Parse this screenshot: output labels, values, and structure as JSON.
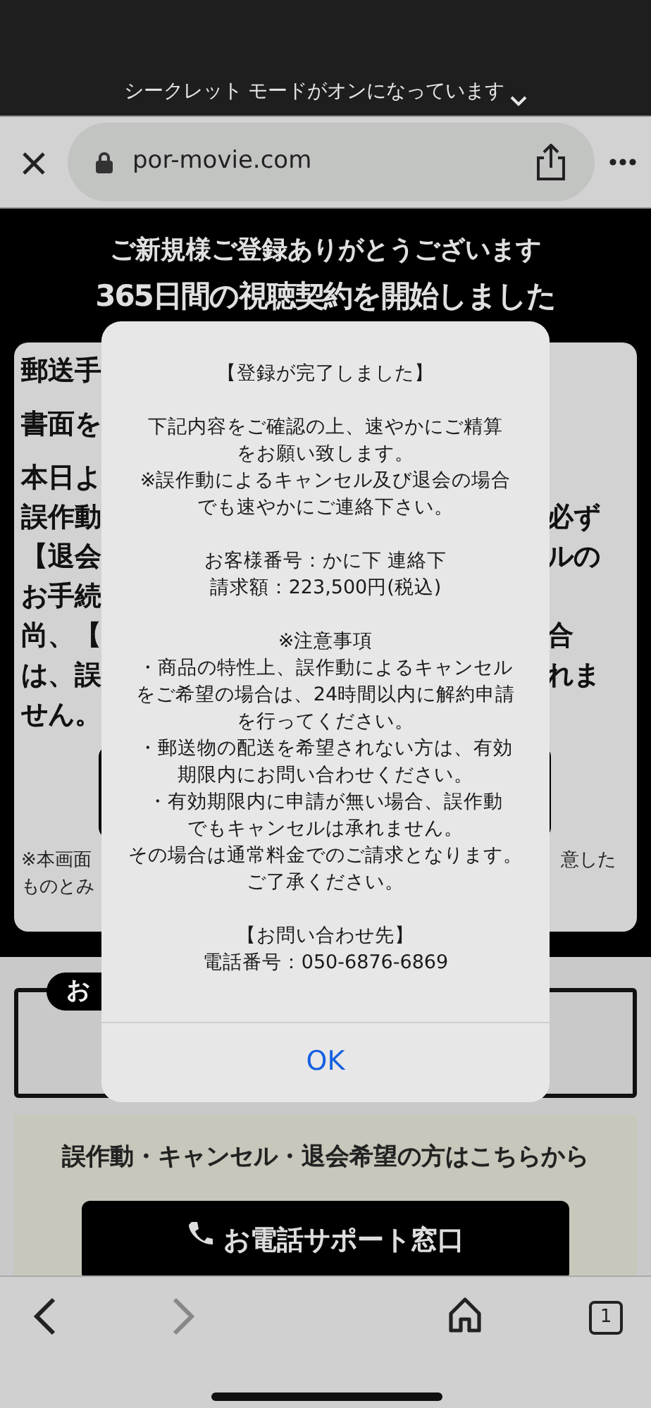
{
  "status_banner": {
    "text": "シークレット モードがオンになっています"
  },
  "address_bar": {
    "url": "por-movie.com"
  },
  "page": {
    "header": {
      "line_1": "ご新規様ご登録ありがとうございます",
      "line_2": "365日間の視聴契約を開始しました"
    },
    "notice_card": {
      "paragraphs": [
        [
          {
            "left": "郵送手"
          }
        ],
        [
          {
            "left": "書面を"
          }
        ],
        [
          {
            "left": "本日よ"
          },
          {
            "left": "誤作動",
            "right": "必ず"
          },
          {
            "left": "【退会",
            "right": "ルの"
          },
          {
            "left": "お手続"
          },
          {
            "left": "尚、【",
            "right": "合"
          },
          {
            "left": "は、誤",
            "right": "れま"
          },
          {
            "left": "せん。"
          }
        ]
      ],
      "note_lines": [
        {
          "left": "※本画面",
          "right": "意した"
        },
        {
          "left": "ものとみ"
        }
      ]
    },
    "customer_box": {
      "badge": "お"
    },
    "support": {
      "heading": "誤作動・キャンセル・退会希望の方はこちらから",
      "button": "お電話サポート窓口"
    }
  },
  "dialog": {
    "paragraphs": [
      [
        "【登録が完了しました】"
      ],
      [
        "下記内容をご確認の上、速やかにご精算",
        "をお願い致します。",
        "※誤作動によるキャンセル及び退会の場合",
        "でも速やかにご連絡下さい。"
      ],
      [
        "お客様番号：かに下 連絡下",
        "請求額：223,500円(税込)"
      ],
      [
        "※注意事項",
        "・商品の特性上、誤作動によるキャンセル",
        "をご希望の場合は、24時間以内に解約申請",
        "を行ってください。",
        "・郵送物の配送を希望されない方は、有効",
        "期限内にお問い合わせください。",
        "・有効期限内に申請が無い場合、誤作動",
        "でもキャンセルは承れません。",
        "その場合は通常料金でのご請求となります。",
        "ご了承ください。"
      ],
      [
        "【お問い合わせ先】",
        "電話番号：050-6876-6869"
      ]
    ],
    "button": "OK"
  },
  "toolbar": {
    "back_enabled": true,
    "forward_enabled": false,
    "tab_count": "1"
  }
}
